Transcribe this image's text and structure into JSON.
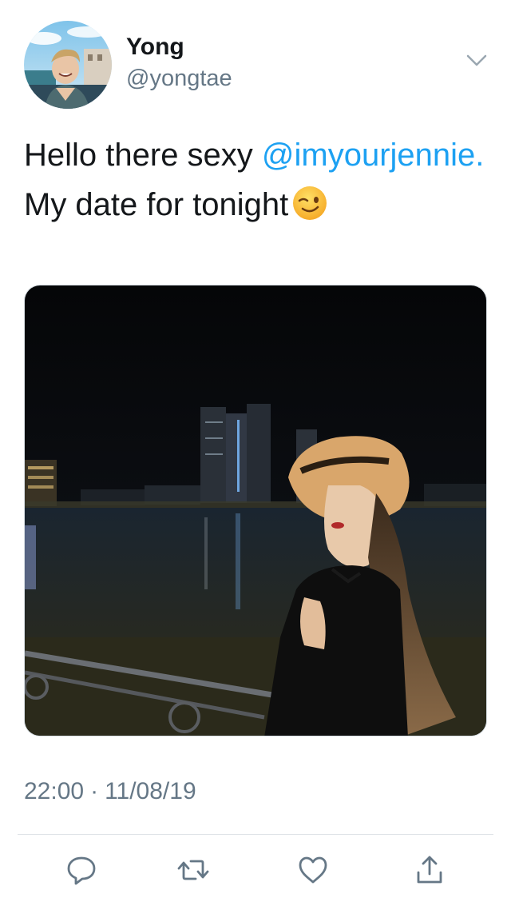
{
  "user": {
    "display_name": "Yong",
    "handle": "@yongtae",
    "avatar_icon": "profile-photo"
  },
  "tweet": {
    "text_before": "Hello there sexy ",
    "mention": "@imyourjennie.",
    "text_after": " My date for tonight",
    "emoji_icon": "winking-face-emoji",
    "time": "22:00",
    "separator": "·",
    "date": "11/08/19"
  },
  "actions": [
    {
      "name": "reply",
      "icon": "speech-bubble-icon"
    },
    {
      "name": "retweet",
      "icon": "retweet-arrows-icon"
    },
    {
      "name": "like",
      "icon": "heart-icon"
    },
    {
      "name": "share",
      "icon": "share-upload-icon"
    }
  ],
  "colors": {
    "text": "#14171a",
    "secondary": "#657786",
    "link": "#1da1f2",
    "divider": "#dfe4e8"
  }
}
